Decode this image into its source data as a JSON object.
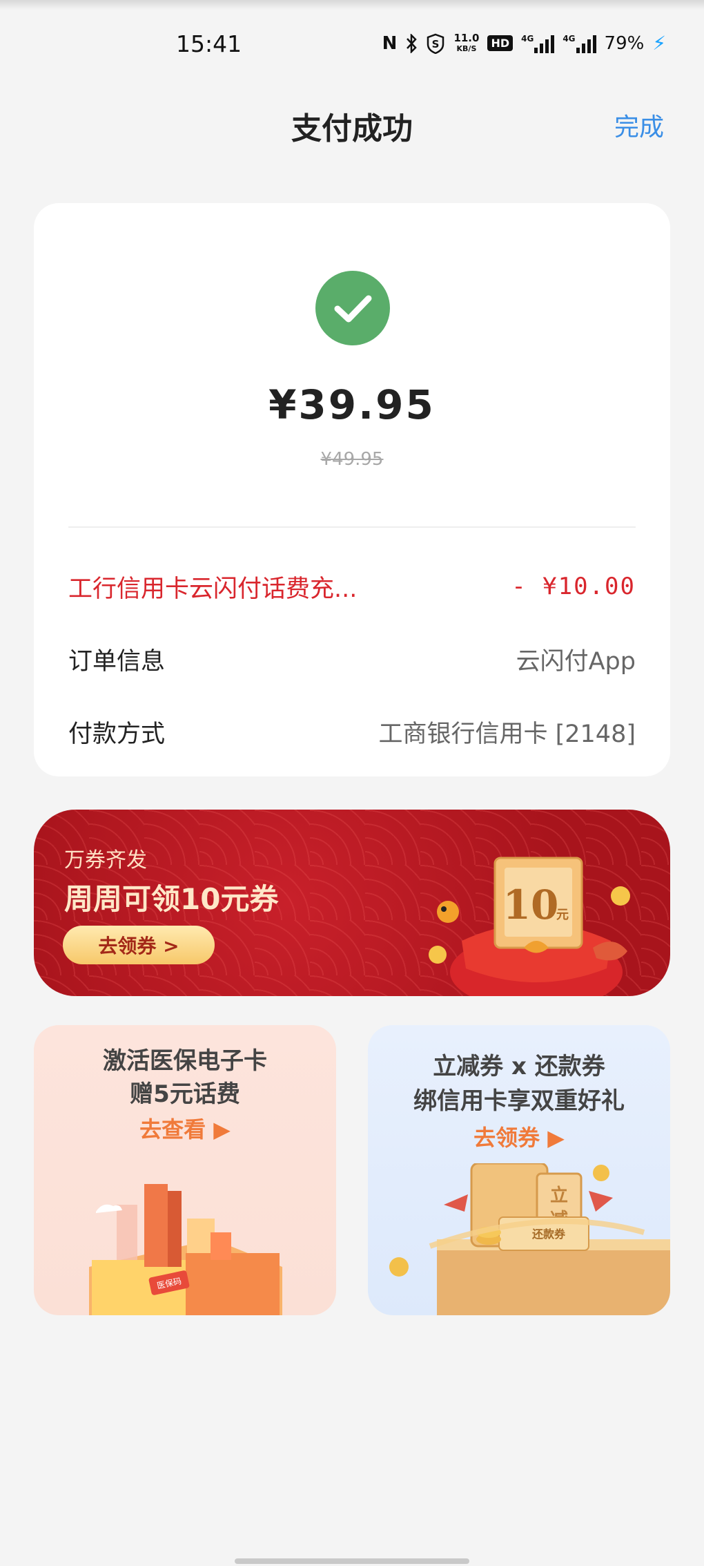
{
  "status_bar": {
    "time": "15:41",
    "net_speed_value": "11.0",
    "net_speed_unit": "KB/S",
    "hd_badge": "HD",
    "sim1_label": "4G",
    "sim2_label": "4G",
    "battery_percent": "79%",
    "icons": [
      "nfc-icon",
      "bluetooth-icon",
      "shield-s-icon",
      "charging-icon"
    ]
  },
  "header": {
    "title": "支付成功",
    "done_label": "完成"
  },
  "result": {
    "amount": "¥39.95",
    "original_amount": "¥49.95",
    "success_color": "#5aad6a"
  },
  "details": {
    "promo_label": "工行信用卡云闪付话费充...",
    "promo_value": "- ¥10.00",
    "order_label": "订单信息",
    "order_value": "云闪付App",
    "payment_label": "付款方式",
    "payment_value": "工商银行信用卡 [2148]"
  },
  "banner": {
    "tag": "万券齐发",
    "title": "周周可领10元券",
    "button_label": "去领券 >",
    "coupon_value": "10",
    "coupon_unit": "元"
  },
  "promo_cards": {
    "left": {
      "line1": "激活医保电子卡",
      "line2": "赠5元话费",
      "link": "去查看 ▶",
      "tag": "医保码"
    },
    "right": {
      "line1": "立减券 x 还款券",
      "line2": "绑信用卡享双重好礼",
      "link": "去领券 ▶",
      "coupon_text1": "立",
      "coupon_text2": "减",
      "tag": "还款券"
    }
  },
  "colors": {
    "accent_blue": "#3a8ee6",
    "discount_red": "#d9262d",
    "banner_red": "#b5161f"
  }
}
